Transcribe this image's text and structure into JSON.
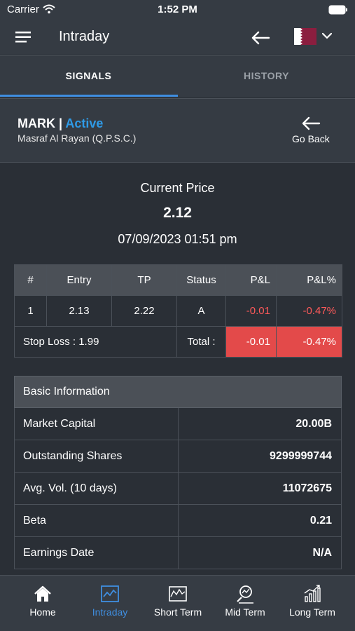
{
  "status_bar": {
    "carrier": "Carrier",
    "time": "1:52 PM"
  },
  "nav": {
    "title": "Intraday",
    "flag_color": "#8b1e3f",
    "language_selector": "flag-qatar"
  },
  "tabs": [
    {
      "label": "SIGNALS",
      "active": true
    },
    {
      "label": "HISTORY",
      "active": false
    }
  ],
  "stock": {
    "symbol": "MARK",
    "separator": " | ",
    "status": "Active",
    "name": "Masraf Al Rayan (Q.P.S.C.)",
    "go_back": "Go Back"
  },
  "price": {
    "label": "Current Price",
    "value": "2.12",
    "timestamp": "07/09/2023 01:51 pm"
  },
  "signal_table": {
    "headers": [
      "#",
      "Entry",
      "TP",
      "Status",
      "P&L",
      "P&L%"
    ],
    "row": {
      "num": "1",
      "entry": "2.13",
      "tp": "2.22",
      "status": "A",
      "pl": "-0.01",
      "pl_pct": "-0.47%"
    },
    "stop_loss": "Stop Loss : 1.99",
    "total_label": "Total :",
    "total_pl": "-0.01",
    "total_pl_pct": "-0.47%"
  },
  "basic_info": {
    "title": "Basic Information",
    "rows": [
      {
        "label": "Market Capital",
        "value": "20.00B"
      },
      {
        "label": "Outstanding Shares",
        "value": "9299999744"
      },
      {
        "label": "Avg. Vol. (10 days)",
        "value": "11072675"
      },
      {
        "label": "Beta",
        "value": "0.21"
      },
      {
        "label": "Earnings Date",
        "value": "N/A"
      }
    ]
  },
  "bottom_nav": [
    {
      "label": "Home",
      "icon": "home-icon",
      "active": false
    },
    {
      "label": "Intraday",
      "icon": "intraday-chart-icon",
      "active": true
    },
    {
      "label": "Short Term",
      "icon": "short-term-chart-icon",
      "active": false
    },
    {
      "label": "Mid Term",
      "icon": "mid-term-analysis-icon",
      "active": false
    },
    {
      "label": "Long Term",
      "icon": "long-term-chart-icon",
      "active": false
    }
  ],
  "colors": {
    "accent": "#3f8ee0",
    "active_status": "#2f9ae6",
    "negative": "#ff5a5a",
    "negative_bg": "#e34a4a",
    "background": "#2a2f36"
  }
}
